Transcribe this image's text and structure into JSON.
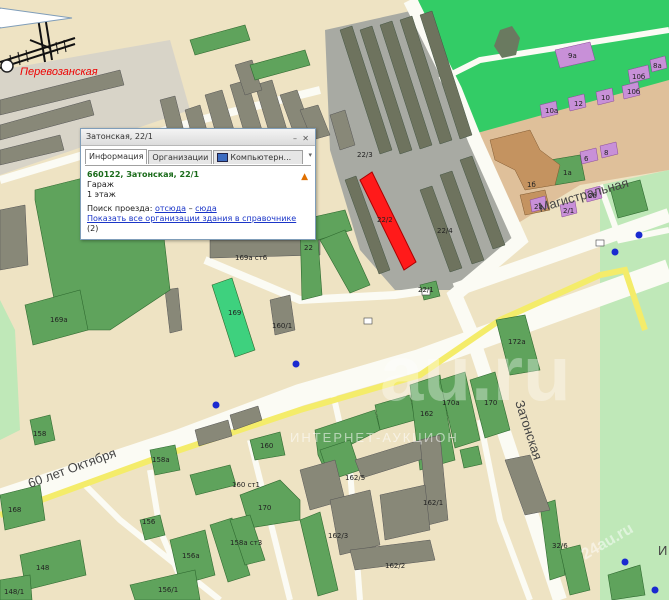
{
  "map": {
    "streets": {
      "perevoz": "Перевозанская",
      "magistral": "Магистральная",
      "oktyabrya": "60 лет Октября",
      "zatonskaya": "Затонская"
    },
    "buildings": {
      "b22_3": "22/3",
      "b22_2": "22/2",
      "b22_4": "22/4",
      "b22": "22",
      "b22_1": "22/1",
      "b169a": "169а",
      "b169ct": "169а ст6",
      "b169": "169",
      "b160_1": "160/1",
      "b172a": "172а",
      "b162": "162",
      "b170": "170",
      "b170a": "170а",
      "b160": "160",
      "b160ct": "160 ст1",
      "b162_5": "162/5",
      "b162_1": "162/1",
      "b162_3": "162/3",
      "b162_2": "162/2",
      "b156": "156",
      "b156a": "156а",
      "b156_1": "156/1",
      "b148": "148",
      "b148_1": "148/1",
      "b158": "158",
      "b158a": "158а",
      "b158ct": "158а ст3",
      "b32_6": "32/6",
      "b168": "168",
      "b9a": "9а",
      "b1a": "1а",
      "b10a": "10а",
      "b12": "12",
      "b10": "10",
      "b10b": "10б",
      "b10c": "10б",
      "b1b": "1б",
      "b2a": "2а",
      "b2": "2/1",
      "b1": "1",
      "b2b": "2б",
      "b1c": "1",
      "b6": "6",
      "b8": "8",
      "b8a": "8а"
    },
    "edge_text": "И"
  },
  "popup": {
    "title": "Затонская, 22/1",
    "tabs": [
      "Информация",
      "Организации",
      "Компьютерн..."
    ],
    "address": "660122, Затонская, 22/1",
    "type": "Гараж",
    "floors": "1 этаж",
    "route_label": "Поиск проезда:",
    "route_from": "отсюда",
    "route_dash": "–",
    "route_to": "сюда",
    "orgs_link": "Показать все организации здания в справочнике",
    "orgs_count": "(2)"
  },
  "watermark": {
    "main": "au.ru",
    "sub": "ИНТЕРНЕТ-АУКЦИОН",
    "corner": "24au.ru"
  },
  "colors": {
    "background": "#eee3c3",
    "building": "#5fa35c",
    "garage_area": "#a8aaa3",
    "selected": "#ff1a1a",
    "road": "#fbfbf4",
    "main_road": "#f4ec6a",
    "park": "#33cc66",
    "campus": "#dfc09a"
  }
}
